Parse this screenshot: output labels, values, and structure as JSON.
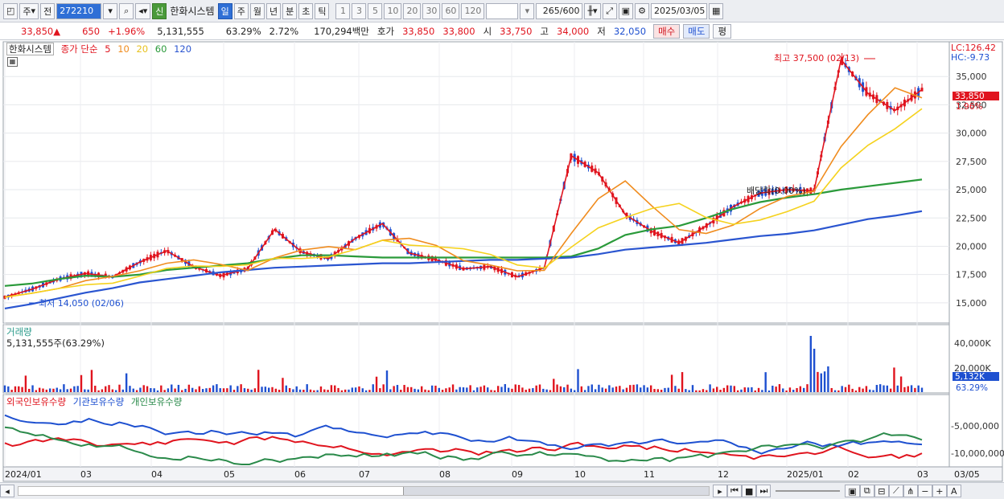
{
  "toolbar": {
    "period": "주",
    "prev": "전",
    "code": "272210",
    "badge": "신",
    "name": "한화시스템",
    "intervals": [
      "일",
      "주",
      "월",
      "년",
      "분",
      "초",
      "틱"
    ],
    "numbers": [
      "1",
      "3",
      "5",
      "10",
      "20",
      "30",
      "60",
      "120"
    ],
    "count": "265",
    "count_total": "/600",
    "date": "2025/03/05"
  },
  "quote": {
    "price": "33,850",
    "price_arrow": "▲",
    "change": "650",
    "change_pct": "+1.96%",
    "volume": "5,131,555",
    "vol_ratio": "63.29%",
    "turnover": "2.72%",
    "amount": "170,294백만",
    "bid_label": "호가",
    "ask": "33,850",
    "bid": "33,800",
    "open_label": "시",
    "open": "33,750",
    "high_label": "고",
    "high": "34,000",
    "low_label": "저",
    "low": "32,050",
    "buy": "매수",
    "sell": "매도",
    "eval": "평"
  },
  "price_panel": {
    "title": "한화시스템",
    "legend_label": "종가 단순",
    "ma_labels": [
      "5",
      "10",
      "20",
      "60",
      "120"
    ],
    "ma_colors": [
      "#e0141e",
      "#f08c1e",
      "#f5d21e",
      "#2a9a3a",
      "#2a55d0"
    ],
    "lc": "LC:126.42",
    "hc": "HC:-9.73",
    "high_note": "최고 37,500 (02/13)",
    "low_note": "최저 14,050 (02/06)",
    "dividend_note": "배당락(0.00%)",
    "last_price_tag": "33,850",
    "last_pct_tag": "1.96%",
    "y_ticks": [
      "35,000",
      "32,500",
      "30,000",
      "27,500",
      "25,000",
      "22,500",
      "20,000",
      "17,500",
      "15,000"
    ]
  },
  "volume_panel": {
    "title": "거래량",
    "value": "5,131,555주(63.29%)",
    "y_ticks": [
      "40,000K",
      "20,000K"
    ],
    "last_tag": "5,132K",
    "last_pct": "63.29%"
  },
  "holding_panel": {
    "labels": [
      "외국인보유수량",
      "기관보유수량",
      "개인보유수량"
    ],
    "colors": [
      "#e0141e",
      "#1e50d0",
      "#2a8a4a"
    ],
    "y_ticks": [
      "-5,000,000",
      "-10,000,000"
    ]
  },
  "x_axis": {
    "labels": [
      "2024/01",
      "03",
      "04",
      "05",
      "06",
      "07",
      "08",
      "09",
      "10",
      "11",
      "12",
      "2025/01",
      "02",
      "03"
    ],
    "right_label": "03/05"
  },
  "chart_data": {
    "type": "line",
    "title": "한화시스템",
    "series": [
      {
        "name": "5",
        "values": [
          15500,
          16200,
          17100,
          17600,
          17300,
          18600,
          19600,
          18200,
          17400,
          18000,
          21500,
          19500,
          18900,
          20700,
          22000,
          19400,
          18800,
          18000,
          18200,
          17300,
          18100,
          28000,
          26500,
          22800,
          21300,
          20300,
          21800,
          23500,
          24700,
          25000,
          24900,
          36500,
          33500,
          32000,
          33850
        ]
      },
      {
        "name": "60",
        "values": [
          16500,
          16700,
          17100,
          17400,
          17300,
          17500,
          17900,
          18100,
          18300,
          18500,
          18900,
          19200,
          19200,
          19100,
          19000,
          19000,
          19000,
          19000,
          19000,
          19000,
          19000,
          19100,
          19800,
          21000,
          21500,
          21800,
          22500,
          23300,
          23900,
          24300,
          24600,
          25000,
          25300,
          25600,
          25900
        ]
      },
      {
        "name": "120",
        "values": [
          14500,
          14900,
          15400,
          15900,
          16300,
          16800,
          17100,
          17400,
          17700,
          17900,
          18100,
          18200,
          18300,
          18400,
          18500,
          18500,
          18600,
          18700,
          18800,
          18800,
          18900,
          19000,
          19300,
          19700,
          19900,
          20100,
          20300,
          20600,
          20900,
          21100,
          21400,
          21900,
          22400,
          22700,
          23100
        ]
      }
    ],
    "ylim": [
      13500,
      37500
    ]
  }
}
